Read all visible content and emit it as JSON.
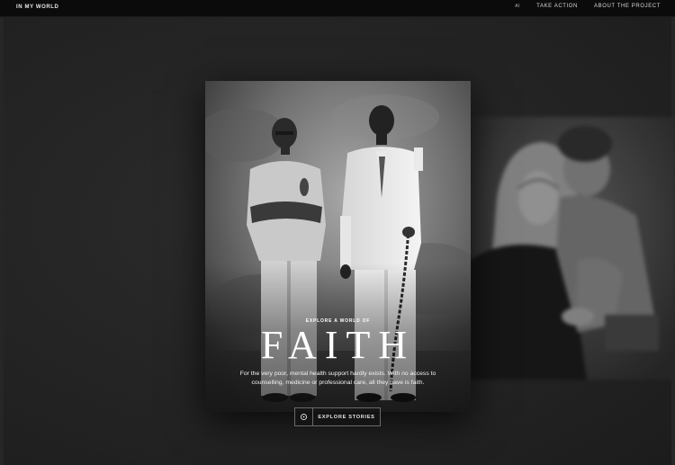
{
  "header": {
    "brand": "IN MY WORLD",
    "nav": {
      "ai": "AI",
      "take_action": "TAKE ACTION",
      "about": "ABOUT THE PROJECT"
    }
  },
  "card": {
    "kicker": "EXPLORE A WORLD OF",
    "title": "FAITH",
    "description": "For the very poor, mental health support hardly exists. With no access to counselling, medicine or professional care, all they have is faith."
  },
  "explore": {
    "label": "EXPLORE STORIES",
    "icon": "target-icon"
  },
  "colors": {
    "background": "#262626",
    "topbar": "#0b0b0b",
    "text": "#ffffff"
  }
}
